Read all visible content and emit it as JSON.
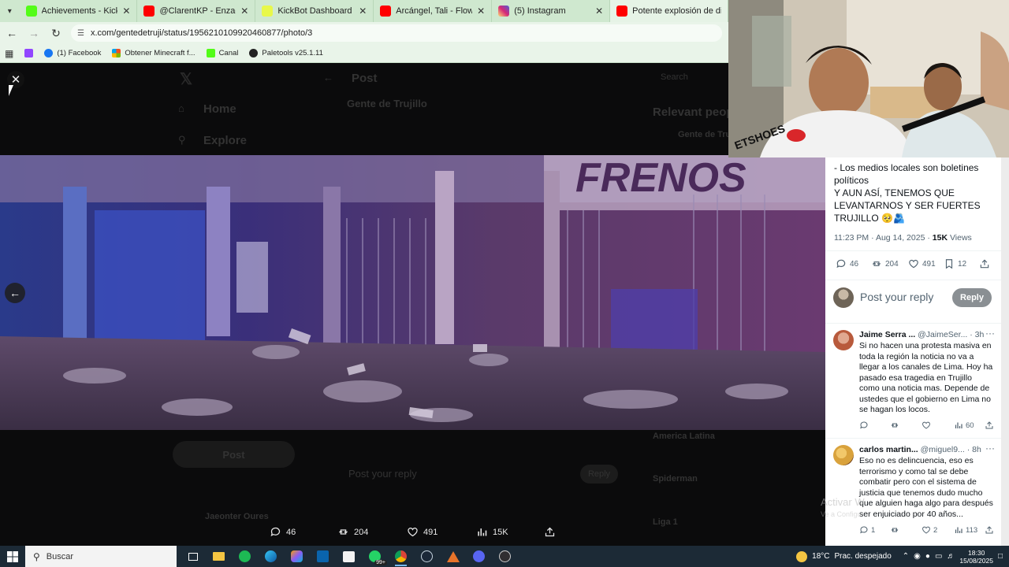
{
  "browser": {
    "tabs": [
      {
        "title": "Achievements - Kick Dashboard",
        "color": "#53fc18"
      },
      {
        "title": "@ClarentKP - Enzaciao - YouTube",
        "color": "#ff0000"
      },
      {
        "title": "KickBot Dashboard",
        "color": "#e8f84a"
      },
      {
        "title": "Arcángel, Tali - Flow Cabrón (V",
        "color": "#ff0000"
      },
      {
        "title": "(5) Instagram",
        "color": "#d62976"
      },
      {
        "title": "Potente explosión de di",
        "color": "#ff0000"
      }
    ],
    "url": "x.com/gentedetruji/status/1956210109920460877/photo/3",
    "bookmarks": [
      {
        "label": "(1) Facebook",
        "color": "#1877f2"
      },
      {
        "label": "Obtener Minecraft f...",
        "color": "#c0392b"
      },
      {
        "label": "Canal",
        "color": "#53fc18"
      },
      {
        "label": "Paletools v25.1.11",
        "color": "#222222"
      }
    ]
  },
  "background_page": {
    "header": "Post",
    "nav_home": "Home",
    "nav_explore": "Explore",
    "account": "Gente de Trujillo",
    "search": "Search",
    "relevant": "Relevant people",
    "post_button": "Post",
    "reply_placeholder": "Post your reply",
    "reply_button": "Reply",
    "trend1": "America Latina",
    "trend2": "Spiderman",
    "trend3": "Liga 1",
    "user": "Jaeonter Oures"
  },
  "viewer": {
    "close_label": "Close",
    "photo_caption_text": "FRENOS",
    "actions": {
      "replies": "46",
      "reposts": "204",
      "likes": "491",
      "views": "15K"
    }
  },
  "panel": {
    "tweet_text_lines": [
      "- Los medios locales son boletines políticos",
      "Y AUN ASÍ, TENEMOS QUE LEVANTARNOS Y SER FUERTES TRUJILLO 🥺🫂"
    ],
    "time": "11:23 PM",
    "date": "Aug 14, 2025",
    "views_count": "15K",
    "views_label": "Views",
    "stats": {
      "replies": "46",
      "reposts": "204",
      "likes": "491",
      "bookmarks": "12"
    },
    "reply_placeholder": "Post your reply",
    "reply_button": "Reply",
    "comments": [
      {
        "name": "Jaime Serra ...",
        "handle": "@JaimeSer...",
        "time": "3h",
        "text": "Si no hacen una protesta masiva en toda la región la noticia no va a llegar a los canales de Lima. Hoy ha pasado esa tragedia en Trujillo como una noticia mas. Depende de ustedes que el gobierno en Lima no se hagan los locos.",
        "views": "60",
        "avatar": "#b85a3c"
      },
      {
        "name": "carlos martin...",
        "handle": "@miguel9...",
        "time": "8h",
        "text": "Eso no es delincuencia, eso es terrorismo y como tal se debe combatir pero con el sistema de justicia que tenemos dudo mucho que alguien haga algo para después ser enjuiciado por 40 años...",
        "replies": "1",
        "likes": "2",
        "views": "113",
        "avatar": "#d9a23c"
      }
    ],
    "watermark": "Activar W",
    "watermark_sub": "Ve a Configu"
  },
  "taskbar": {
    "search_placeholder": "Buscar",
    "weather_temp": "18°C",
    "weather_text": "Prac. despejado",
    "time": "18:30",
    "date": "15/08/2025",
    "badge": "99+"
  }
}
